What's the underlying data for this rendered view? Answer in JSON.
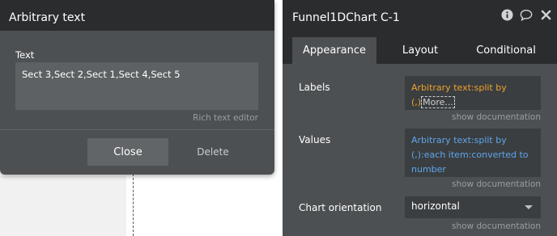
{
  "text_popup": {
    "title": "Arbitrary text",
    "field_label": "Text",
    "text_value": "Sect 3,Sect 2,Sect 1,Sect 4,Sect 5",
    "rich_text_editor": "Rich text editor",
    "close_label": "Close",
    "delete_label": "Delete"
  },
  "element_panel": {
    "title": "Funnel1DChart C-1",
    "icons": [
      "info-icon",
      "comment-icon",
      "close-icon"
    ],
    "tabs": [
      {
        "label": "Appearance",
        "active": true
      },
      {
        "label": "Layout",
        "active": false
      },
      {
        "label": "Conditional",
        "active": false
      }
    ],
    "labels": {
      "label": "Labels",
      "expression": "Arbitrary text:split by (,)",
      "more": "More...",
      "doc": "show documentation"
    },
    "values": {
      "label": "Values",
      "expression": "Arbitrary text:split by (,):each item:converted to number",
      "doc": "show documentation"
    },
    "orientation": {
      "label": "Chart orientation",
      "selected": "horizontal",
      "doc": "show documentation"
    }
  },
  "colors": {
    "panel_bg": "#4d5052",
    "header_bg": "#2a2c2e",
    "expression_orange": "#f0a02c",
    "expression_blue": "#5ca6ee"
  }
}
